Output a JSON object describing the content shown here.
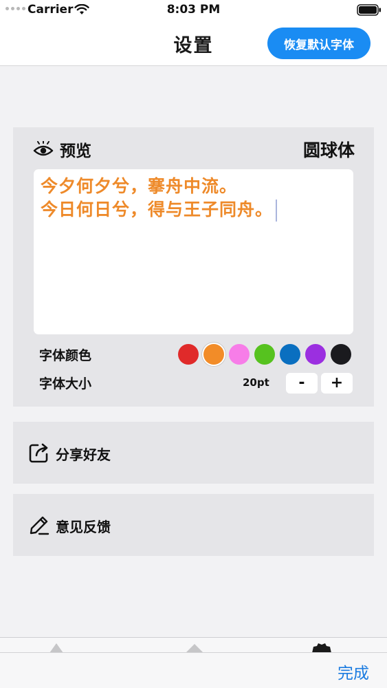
{
  "status_bar": {
    "carrier": "Carrier",
    "time": "8:03 PM"
  },
  "nav": {
    "title": "设置",
    "restore_button": "恢复默认字体"
  },
  "preview": {
    "label": "预览",
    "font_name": "圆球体",
    "lines": [
      "今夕何夕兮，搴舟中流。",
      "今日何日兮，得与王子同舟。"
    ],
    "text_color": "#ee8a2a"
  },
  "font_color": {
    "label": "字体颜色",
    "swatches": [
      {
        "color": "#e02a2a",
        "selected": false
      },
      {
        "color": "#f28c28",
        "selected": true
      },
      {
        "color": "#f77de8",
        "selected": false
      },
      {
        "color": "#56c21f",
        "selected": false
      },
      {
        "color": "#0a6fc0",
        "selected": false
      },
      {
        "color": "#9b2fe0",
        "selected": false
      },
      {
        "color": "#1a1a1e",
        "selected": false
      }
    ]
  },
  "font_size": {
    "label": "字体大小",
    "value": "20pt",
    "minus": "-",
    "plus": "+"
  },
  "rows": {
    "share": "分享好友",
    "feedback": "意见反馈"
  },
  "toolbar": {
    "done": "完成"
  },
  "colors": {
    "accent": "#1a8cf3",
    "card": "#e5e5e8",
    "background": "#f2f2f4"
  },
  "icons": {
    "eye": "eye-icon",
    "share": "share-icon",
    "feedback": "pencil-icon",
    "wifi": "wifi-icon",
    "battery": "battery-icon"
  }
}
